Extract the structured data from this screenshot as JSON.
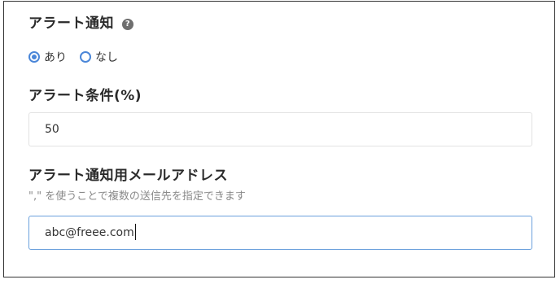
{
  "alert_notice": {
    "title": "アラート通知",
    "help_icon": "?",
    "options": [
      {
        "label": "あり",
        "checked": true
      },
      {
        "label": "なし",
        "checked": false
      }
    ]
  },
  "alert_condition": {
    "title": "アラート条件(%)",
    "value": "50"
  },
  "alert_email": {
    "title": "アラート通知用メールアドレス",
    "hint": "\",\" を使うことで複数の送信先を指定できます",
    "value": "abc@freee.com"
  },
  "colors": {
    "accent": "#4a86d8",
    "focus_border": "#6aa0dc",
    "hint_text": "#8a8a8a"
  }
}
